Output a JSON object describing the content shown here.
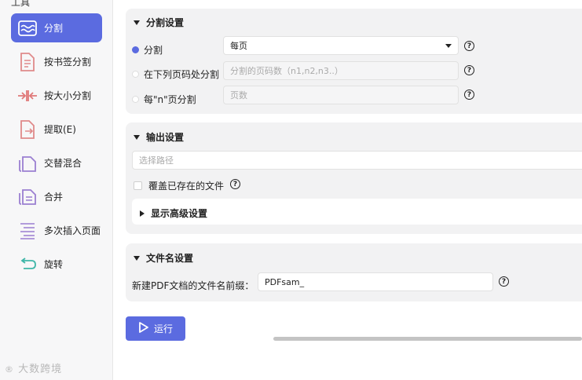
{
  "sidebar": {
    "title": "工具",
    "items": [
      {
        "label": "分割",
        "icon": "split-wave-icon",
        "active": true
      },
      {
        "label": "按书签分割",
        "icon": "bookmark-document-icon"
      },
      {
        "label": "按大小分割",
        "icon": "split-size-icon"
      },
      {
        "label": "提取(E)",
        "icon": "extract-document-icon"
      },
      {
        "label": "交替混合",
        "icon": "alternate-mix-icon"
      },
      {
        "label": "合并",
        "icon": "merge-document-icon"
      },
      {
        "label": "多次插入页面",
        "icon": "insert-pages-icon"
      },
      {
        "label": "旋转",
        "icon": "rotate-icon"
      }
    ],
    "watermark": "大数跨境"
  },
  "split_settings": {
    "title": "分割设置",
    "options": [
      {
        "label": "分割",
        "selected": true
      },
      {
        "label": "在下列页码处分割",
        "selected": false
      },
      {
        "label": "每\"n\"页分割",
        "selected": false
      }
    ],
    "mode_select_value": "每页",
    "pages_placeholder": "分割的页码数（n1,n2,n3..）",
    "n_pages_placeholder": "页数",
    "help_glyph": "?"
  },
  "output_settings": {
    "title": "输出设置",
    "path_placeholder": "选择路径",
    "overwrite_label": "覆盖已存在的文件",
    "advanced_label": "显示高级设置"
  },
  "filename_settings": {
    "title": "文件名设置",
    "prefix_label": "新建PDF文档的文件名前缀：",
    "prefix_value": "PDFsam_"
  },
  "run_label": "运行",
  "colors": {
    "accent": "#5b6be0",
    "panel_bg": "#f2f2f3"
  }
}
